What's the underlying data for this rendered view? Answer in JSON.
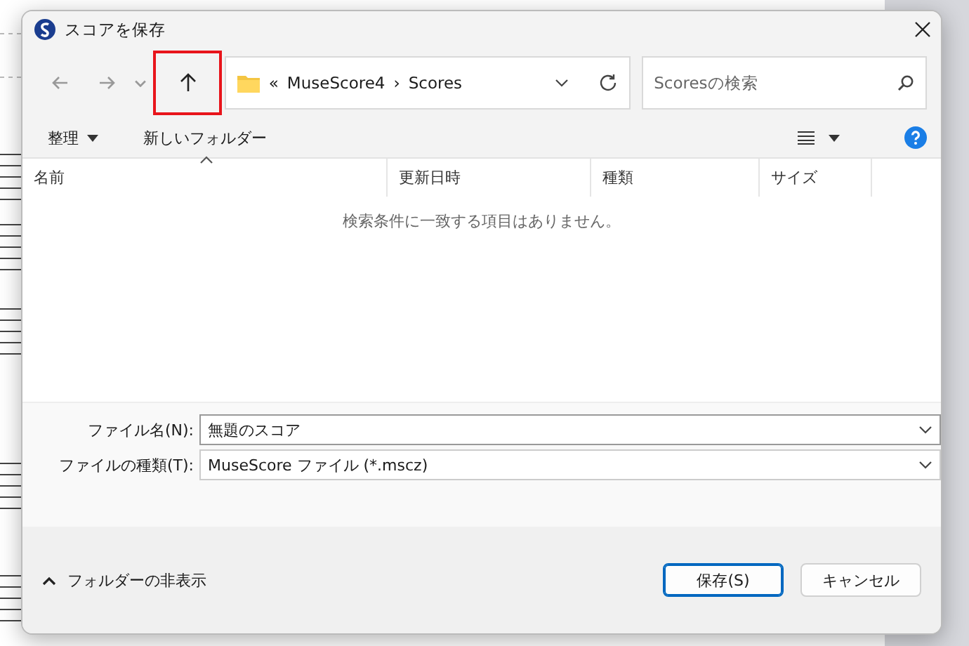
{
  "window": {
    "title": "スコアを保存"
  },
  "nav_buttons": [
    {
      "kind": "back",
      "disabled": true,
      "highlighted": false
    },
    {
      "kind": "forward",
      "disabled": true,
      "highlighted": false
    },
    {
      "kind": "recent",
      "disabled": true,
      "highlighted": false
    },
    {
      "kind": "up",
      "disabled": false,
      "highlighted": true
    }
  ],
  "address": {
    "overflow": "«",
    "path": [
      "MuseScore4",
      "Scores"
    ],
    "separator": "›"
  },
  "search": {
    "placeholder": "Scoresの検索"
  },
  "toolbar": {
    "organize": "整理",
    "new_folder": "新しいフォルダー"
  },
  "columns": [
    {
      "label": "名前",
      "sorted": true
    },
    {
      "label": "更新日時",
      "sorted": false
    },
    {
      "label": "種類",
      "sorted": false
    },
    {
      "label": "サイズ",
      "sorted": false
    }
  ],
  "empty_message": "検索条件に一致する項目はありません。",
  "fields": [
    {
      "label": "ファイル名(N):",
      "value": "無題のスコア"
    },
    {
      "label": "ファイルの種類(T):",
      "value": "MuseScore ファイル (*.mscz)"
    }
  ],
  "hide_folders": "フォルダーの非表示",
  "buttons": [
    {
      "label": "保存(S)",
      "primary": true
    },
    {
      "label": "キャンセル",
      "primary": false
    }
  ]
}
